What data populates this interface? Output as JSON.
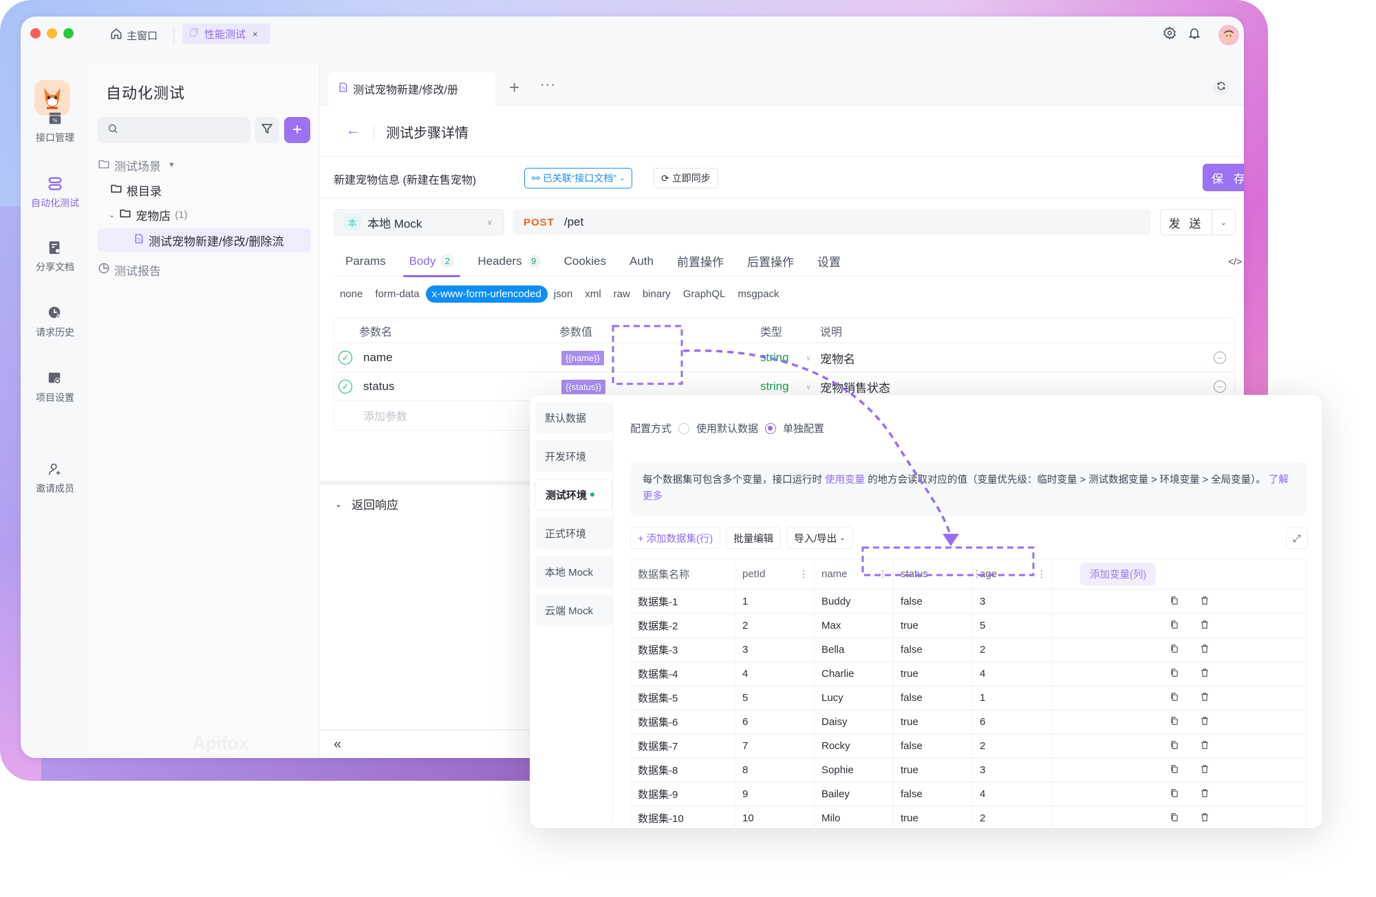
{
  "titlebar": {
    "home_tab": "主窗口",
    "active_tab": "性能测试",
    "close_glyph": "×"
  },
  "nav": {
    "items": [
      {
        "label": "接口管理",
        "icon": "api-icon",
        "active": false
      },
      {
        "label": "自动化测试",
        "icon": "automation-icon",
        "active": true
      },
      {
        "label": "分享文档",
        "icon": "share-doc-icon",
        "active": false
      },
      {
        "label": "请求历史",
        "icon": "history-icon",
        "active": false
      },
      {
        "label": "项目设置",
        "icon": "project-settings-icon",
        "active": false
      },
      {
        "label": "邀请成员",
        "icon": "invite-member-icon",
        "active": false
      }
    ]
  },
  "sidebar": {
    "title": "自动化测试",
    "search_placeholder": "",
    "tree": {
      "scenarios": "测试场景",
      "root": "根目录",
      "folder": "宠物店",
      "folder_count": "(1)",
      "case": "测试宠物新建/修改/删除流",
      "reports": "测试报告"
    },
    "watermark": "Apifox"
  },
  "main": {
    "doc_tab": "测试宠物新建/修改/册",
    "header_title": "测试步骤详情",
    "info_title": "新建宠物信息 (新建在售宠物)",
    "linked_label": "已关联“接口文档”",
    "sync_label": "立即同步",
    "save_label": "保 存",
    "env": {
      "badge": "本",
      "name": "本地 Mock"
    },
    "method": "POST",
    "path": "/pet",
    "send_label": "发 送",
    "tabs": [
      {
        "label": "Params",
        "count": null
      },
      {
        "label": "Body",
        "count": "2"
      },
      {
        "label": "Headers",
        "count": "9"
      },
      {
        "label": "Cookies",
        "count": null
      },
      {
        "label": "Auth",
        "count": null
      },
      {
        "label": "前置操作",
        "count": null
      },
      {
        "label": "后置操作",
        "count": null
      },
      {
        "label": "设置",
        "count": null
      }
    ],
    "active_tab": "Body",
    "body_types": [
      "none",
      "form-data",
      "x-www-form-urlencoded",
      "json",
      "xml",
      "raw",
      "binary",
      "GraphQL",
      "msgpack"
    ],
    "active_body_type": "x-www-form-urlencoded",
    "params": {
      "headers": [
        "参数名",
        "参数值",
        "类型",
        "说明"
      ],
      "rows": [
        {
          "name": "name",
          "value": "{{name}}",
          "type": "string",
          "desc": "宠物名"
        },
        {
          "name": "status",
          "value": "{{status}}",
          "type": "string",
          "desc": "宠物销售状态"
        }
      ],
      "add_placeholder": "添加参数"
    },
    "response_label": "返回响应",
    "collapse_glyph": "«"
  },
  "popover": {
    "envs": [
      {
        "label": "默认数据",
        "active": false
      },
      {
        "label": "开发环境",
        "active": false
      },
      {
        "label": "测试环境",
        "active": true
      },
      {
        "label": "正式环境",
        "active": false
      },
      {
        "label": "本地 Mock",
        "active": false
      },
      {
        "label": "云端 Mock",
        "active": false
      }
    ],
    "config_label": "配置方式",
    "radio_default": "使用默认数据",
    "radio_custom": "单独配置",
    "radio_selected": "单独配置",
    "tip_part1": "每个数据集可包含多个变量，接口运行时",
    "tip_link1": "使用变量",
    "tip_part2": "的地方会读取对应的值（变量优先级：临时变量 > 测试数据变量 > 环境变量 > 全局变量）。",
    "tip_link2": "了解更多",
    "add_dataset": "+ 添加数据集(行)",
    "batch_edit": "批量编辑",
    "import_export": "导入/导出",
    "table": {
      "headers": [
        "数据集名称",
        "petId",
        "name",
        "status",
        "age"
      ],
      "add_column": "添加变量(列)",
      "rows": [
        [
          "数据集-1",
          "1",
          "Buddy",
          "false",
          "3"
        ],
        [
          "数据集-2",
          "2",
          "Max",
          "true",
          "5"
        ],
        [
          "数据集-3",
          "3",
          "Bella",
          "false",
          "2"
        ],
        [
          "数据集-4",
          "4",
          "Charlie",
          "true",
          "4"
        ],
        [
          "数据集-5",
          "5",
          "Lucy",
          "false",
          "1"
        ],
        [
          "数据集-6",
          "6",
          "Daisy",
          "true",
          "6"
        ],
        [
          "数据集-7",
          "7",
          "Rocky",
          "false",
          "2"
        ],
        [
          "数据集-8",
          "8",
          "Sophie",
          "true",
          "3"
        ],
        [
          "数据集-9",
          "9",
          "Bailey",
          "false",
          "4"
        ],
        [
          "数据集-10",
          "10",
          "Milo",
          "true",
          "2"
        ]
      ]
    }
  },
  "colors": {
    "accent": "#9a72f2",
    "link_blue": "#1a8cf0",
    "post": "#f0641e",
    "string_type": "#12a05c",
    "active_dot": "#12b76a"
  }
}
